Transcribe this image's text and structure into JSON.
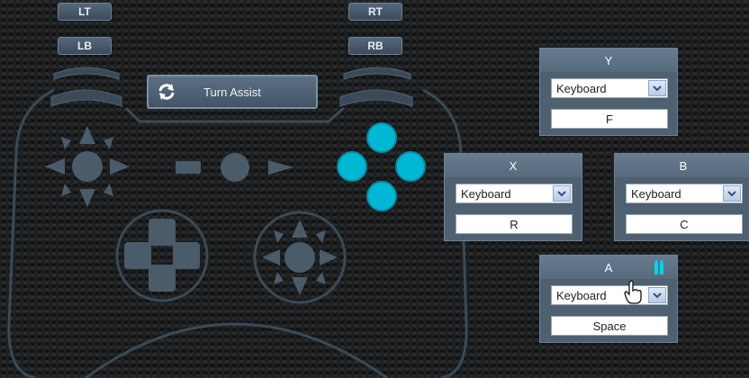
{
  "shoulder_buttons": {
    "lt": "LT",
    "rt": "RT",
    "lb": "LB",
    "rb": "RB"
  },
  "turn_assist": {
    "label": "Turn Assist",
    "icon": "refresh-icon"
  },
  "mappings": {
    "y": {
      "title": "Y",
      "device": "Keyboard",
      "key": "F"
    },
    "x": {
      "title": "X",
      "device": "Keyboard",
      "key": "R"
    },
    "b": {
      "title": "B",
      "device": "Keyboard",
      "key": "C"
    },
    "a": {
      "title": "A",
      "device": "Keyboard",
      "key": "Space",
      "badge_icon": "double-tap-icon"
    }
  },
  "colors": {
    "accent": "#00b8d4",
    "outline": "#3a4a58",
    "panel": "#4f6071"
  }
}
